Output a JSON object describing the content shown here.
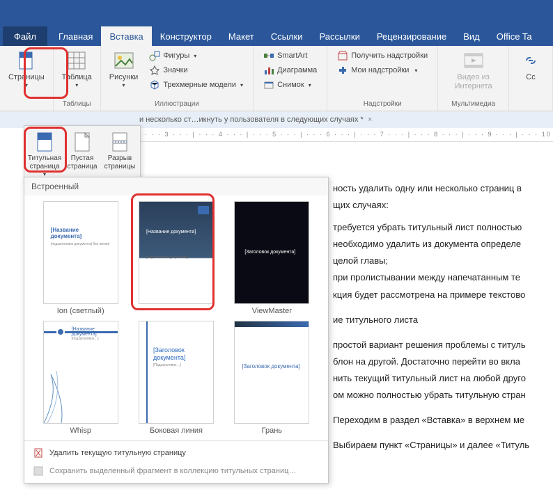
{
  "tabs": {
    "file": "Файл",
    "home": "Главная",
    "insert": "Вставка",
    "design": "Конструктор",
    "layout": "Макет",
    "references": "Ссылки",
    "mailings": "Рассылки",
    "review": "Рецензирование",
    "view": "Вид",
    "office": "Office Ta"
  },
  "ribbon": {
    "pages": {
      "label": "Страницы",
      "group": "Таблицы"
    },
    "table": {
      "label": "Таблица",
      "group": "Таблицы"
    },
    "pictures": {
      "label": "Рисунки"
    },
    "shapes": "Фигуры",
    "icons": "Значки",
    "models3d": "Трехмерные модели",
    "illustrations_group": "Иллюстрации",
    "smartart": "SmartArt",
    "chart": "Диаграмма",
    "screenshot": "Снимок",
    "get_addins": "Получить надстройки",
    "my_addins": "Мои надстройки",
    "addins_group": "Надстройки",
    "video": "Видео из Интернета",
    "media_group": "Мультимедиа",
    "links": "Сс"
  },
  "pages_dropdown": {
    "cover": "Титульная страница",
    "blank": "Пустая страница",
    "break": "Разрыв страницы"
  },
  "doc_tab": "и несколько ст…икнуть у пользователя в следующих случаях *",
  "ruler_text": "· · · 3 · · · | · · · 4 · · · | · · · 5 · · · | · · · 6 · · · | · · · 7 · · · | · · · 8 · · · | · · · 9 · · · | · · · 10",
  "gallery": {
    "header": "Встроенный",
    "items": [
      {
        "name": "Ion (светлый)",
        "thumb_title": "[Название документа]",
        "thumb_sub": "|подзаголовок документа| без метки|"
      },
      {
        "name": "",
        "thumb_title": "[Название документа]",
        "thumb_sub": "[подзаголовок документа]"
      },
      {
        "name": "ViewMaster",
        "thumb_title": "[Заголовок документа]",
        "thumb_sub": ""
      },
      {
        "name": "Whisp",
        "thumb_title": "[Название документа]",
        "thumb_sub": "[подзаголовок…]"
      },
      {
        "name": "Боковая линия",
        "thumb_title": "[Заголовок документа]",
        "thumb_sub": "[Подзаголовок…]"
      },
      {
        "name": "Грань",
        "thumb_title": "[Заголовок документа]",
        "thumb_sub": ""
      }
    ],
    "footer_delete": "Удалить текущую титульную страницу",
    "footer_save": "Сохранить выделенный фрагмент в коллекцию титульных страниц…"
  },
  "doc": {
    "p1": "ность удалить одну или несколько страниц в",
    "p2": "щих случаях:",
    "p3": "требуется убрать титульный лист полностью",
    "p4": "необходимо удалить из документа определе",
    "p5": "целой главы;",
    "p6": "при пролистывании между напечатанным те",
    "p7": "кция будет рассмотрена на примере текстово",
    "p8": "ие титульного листа",
    "p9": "простой вариант решения проблемы с титуль",
    "p10": "блон на другой. Достаточно перейти во вкла",
    "p11": "нить текущий титульный лист на любой друго",
    "p12": "ом можно полностью убрать титульную стран",
    "p13": "Переходим в раздел «Вставка» в верхнем ме",
    "p14": "Выбираем пункт «Страницы» и далее «Титуль"
  }
}
